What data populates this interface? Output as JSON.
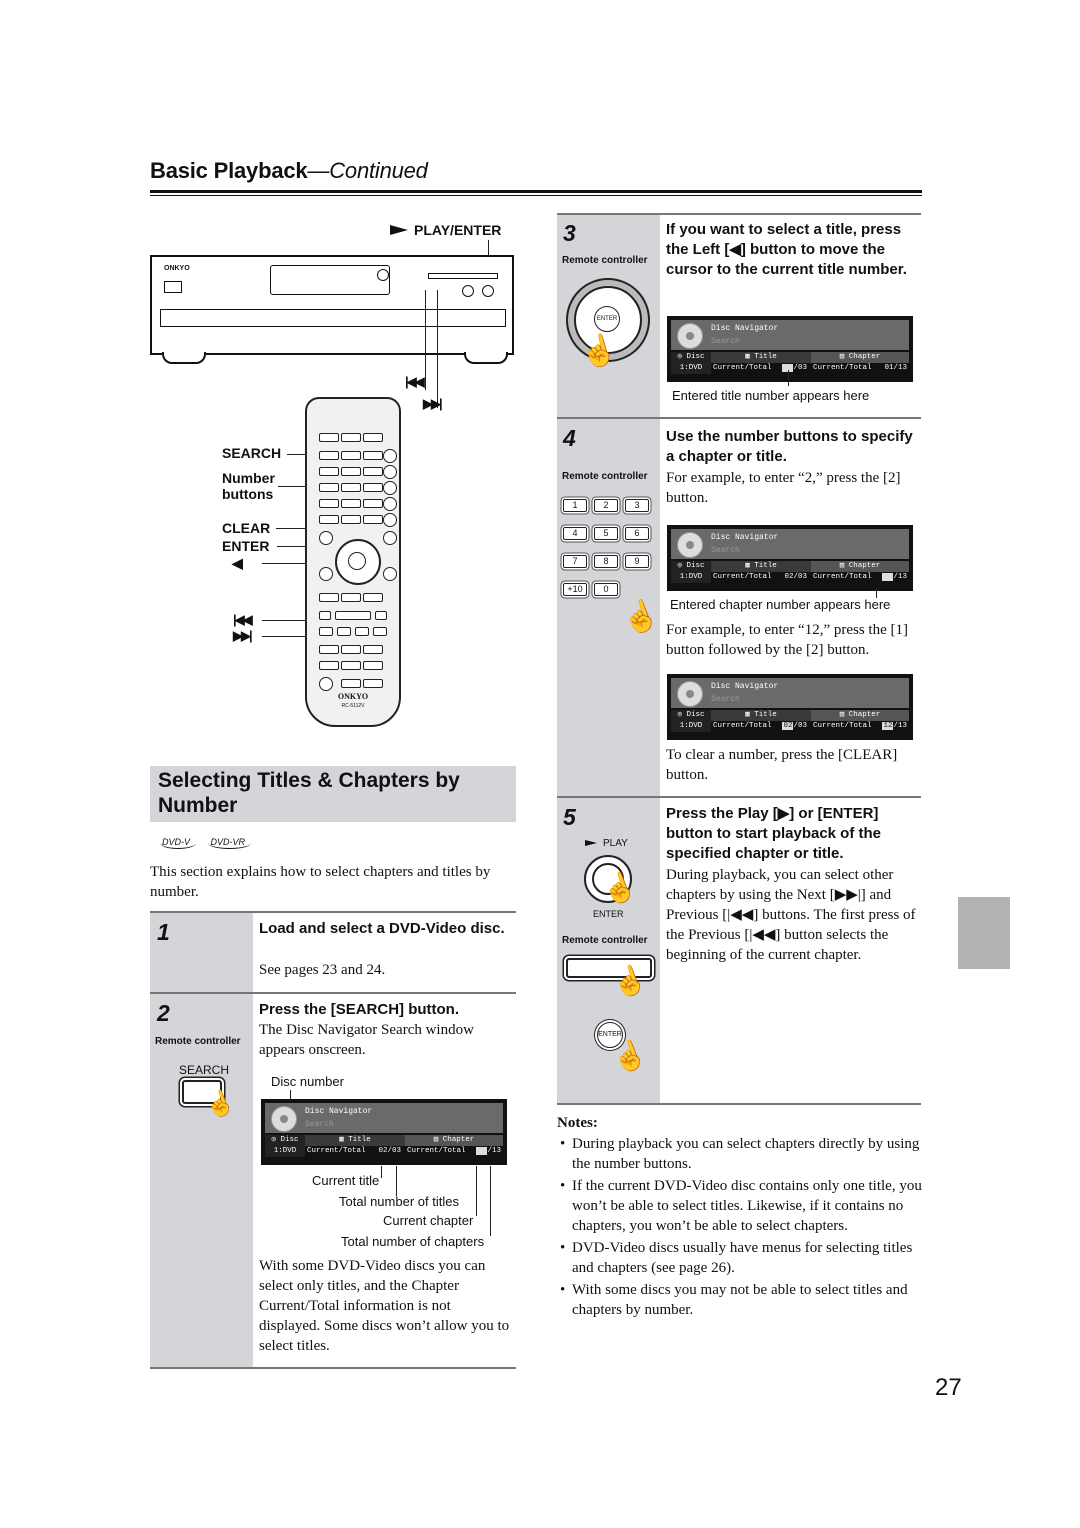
{
  "header": {
    "title_bold": "Basic Playback",
    "title_italic": "—Continued"
  },
  "diagram": {
    "play_enter_label": "PLAY/ENTER",
    "prev_label": "◀◀",
    "next_label": "▶▶",
    "brand": "ONKYO",
    "remote_model": "RC-5112V",
    "remote_labels": {
      "search": "SEARCH",
      "number_buttons_line1": "Number",
      "number_buttons_line2": "buttons",
      "clear": "CLEAR",
      "enter": "ENTER",
      "left": "◀"
    }
  },
  "section": {
    "title_line1": "Selecting Titles & Chapters by",
    "title_line2": "Number",
    "badges": [
      "DVD-V",
      "DVD-VR"
    ],
    "intro": "This section explains how to select chapters and titles by number."
  },
  "steps": [
    {
      "num": "1",
      "heading": "Load and select a DVD-Video disc.",
      "body": "See pages 23 and 24."
    },
    {
      "num": "2",
      "rc_label": "Remote controller",
      "button": "SEARCH",
      "heading": "Press the [SEARCH] button.",
      "body": "The Disc Navigator Search window appears onscreen.",
      "callouts": {
        "disc_number": "Disc number",
        "current_title": "Current title",
        "total_titles": "Total number of titles",
        "current_chapter": "Current chapter",
        "total_chapters": "Total number of chapters"
      },
      "after": "With some DVD-Video discs you can select only titles, and the Chapter Current/Total information is not displayed. Some discs won’t allow you to select titles."
    },
    {
      "num": "3",
      "rc_label": "Remote controller",
      "enter": "ENTER",
      "heading": "If you want to select a title, press the Left [◀] button to move the cursor to the current title number.",
      "caption": "Entered title number appears here"
    },
    {
      "num": "4",
      "rc_label": "Remote controller",
      "keys": [
        "1",
        "2",
        "3",
        "4",
        "5",
        "6",
        "7",
        "8",
        "9",
        "+10",
        "0"
      ],
      "heading": "Use the number buttons to specify a chapter or title.",
      "body1": "For example, to enter “2,” press the [2] button.",
      "caption": "Entered chapter number appears here",
      "body2": "For example, to enter “12,” press the [1] button followed by the [2] button.",
      "body3": "To clear a number, press the [CLEAR] button."
    },
    {
      "num": "5",
      "play": "PLAY",
      "enter": "ENTER",
      "rc_label": "Remote controller",
      "heading": "Press the Play [▶] or [ENTER] button to start playback of the specified chapter or title.",
      "body": "During playback, you can select other chapters by using the Next [▶▶|] and Previous [|◀◀] buttons. The first press of the Previous [|◀◀] button selects the beginning of the current chapter."
    }
  ],
  "navigator": {
    "title": "Disc Navigator",
    "subtitle": "Search",
    "col_disc": "Disc",
    "col_title": "Title",
    "col_chapter": "Chapter",
    "disc_value": "1:DVD",
    "ct_label": "Current/Total",
    "screens": [
      {
        "title_cur": "02",
        "title_total": "/03",
        "chap_cur": "  ",
        "chap_total": "/13"
      },
      {
        "title_cur": "  ",
        "title_total": "/03",
        "chap_cur": "01",
        "chap_total": "/13"
      },
      {
        "title_cur": "02",
        "title_total": "/03",
        "chap_cur": "  ",
        "chap_total": "/13"
      },
      {
        "title_cur": "02",
        "title_total": "/03",
        "chap_cur": "12",
        "chap_total": "/13"
      }
    ]
  },
  "notes": {
    "heading": "Notes:",
    "items": [
      "During playback you can select chapters directly by using the number buttons.",
      "If the current DVD-Video disc contains only one title, you won’t be able to select titles. Likewise, if it contains no chapters, you won’t be able to select chapters.",
      "DVD-Video discs usually have menus for selecting titles and chapters (see page 26).",
      "With some discs you may not be able to select titles and chapters by number."
    ]
  },
  "page_number": "27"
}
